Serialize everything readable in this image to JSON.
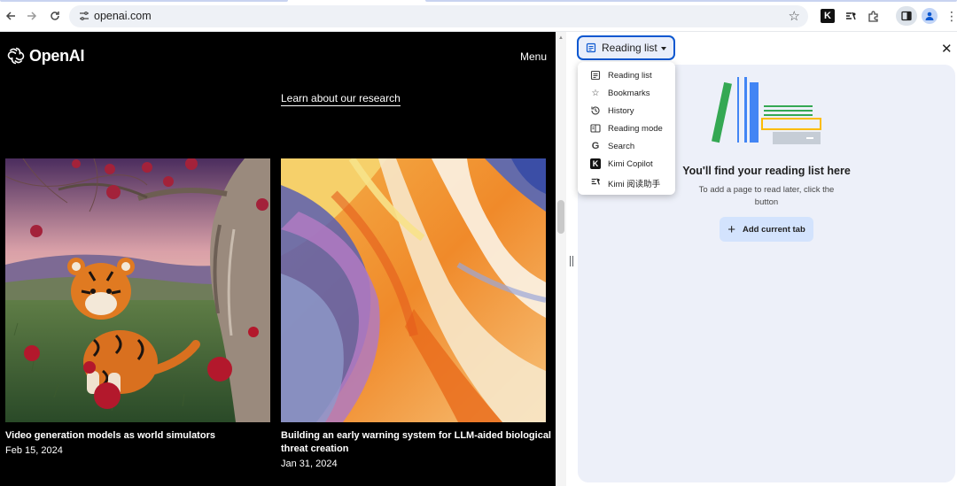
{
  "browser": {
    "url": "openai.com",
    "icons": {
      "back": "arrow-left-icon",
      "forward": "arrow-right-icon",
      "reload": "reload-icon",
      "site_info": "tune-icon",
      "bookmark": "star-icon",
      "kimi_copilot": "kimi-k-icon",
      "kimi_reading": "kimi-reading-icon",
      "extensions": "puzzle-icon",
      "side_panel": "side-panel-icon",
      "profile": "profile-icon",
      "menu": "kebab-icon"
    }
  },
  "page": {
    "logo_text": "OpenAI",
    "menu_label": "Menu",
    "research_link": "Learn about our research",
    "cards": [
      {
        "title": "Video generation models as world simulators",
        "date": "Feb 15, 2024"
      },
      {
        "title": "Building an early warning system for LLM-aided biological threat creation",
        "date": "Jan 31, 2024"
      }
    ]
  },
  "side_panel": {
    "selected": "Reading list",
    "close_icon": "close-icon",
    "menu": [
      {
        "label": "Reading list",
        "icon": "reading-list-icon"
      },
      {
        "label": "Bookmarks",
        "icon": "bookmarks-icon"
      },
      {
        "label": "History",
        "icon": "history-icon"
      },
      {
        "label": "Reading mode",
        "icon": "reading-mode-icon"
      },
      {
        "label": "Search",
        "icon": "google-g-icon"
      },
      {
        "label": "Kimi Copilot",
        "icon": "kimi-k-icon"
      },
      {
        "label": "Kimi 阅读助手",
        "icon": "kimi-reading-icon"
      }
    ],
    "empty_title": "You'll find your reading list here",
    "empty_subtitle": "To add a page to read later, click the button",
    "add_button": "Add current tab"
  },
  "colors": {
    "accent": "#0b57d0",
    "panel_bg": "#edf0f9",
    "button_bg": "#d3e3fd",
    "page_bg": "#000000"
  }
}
